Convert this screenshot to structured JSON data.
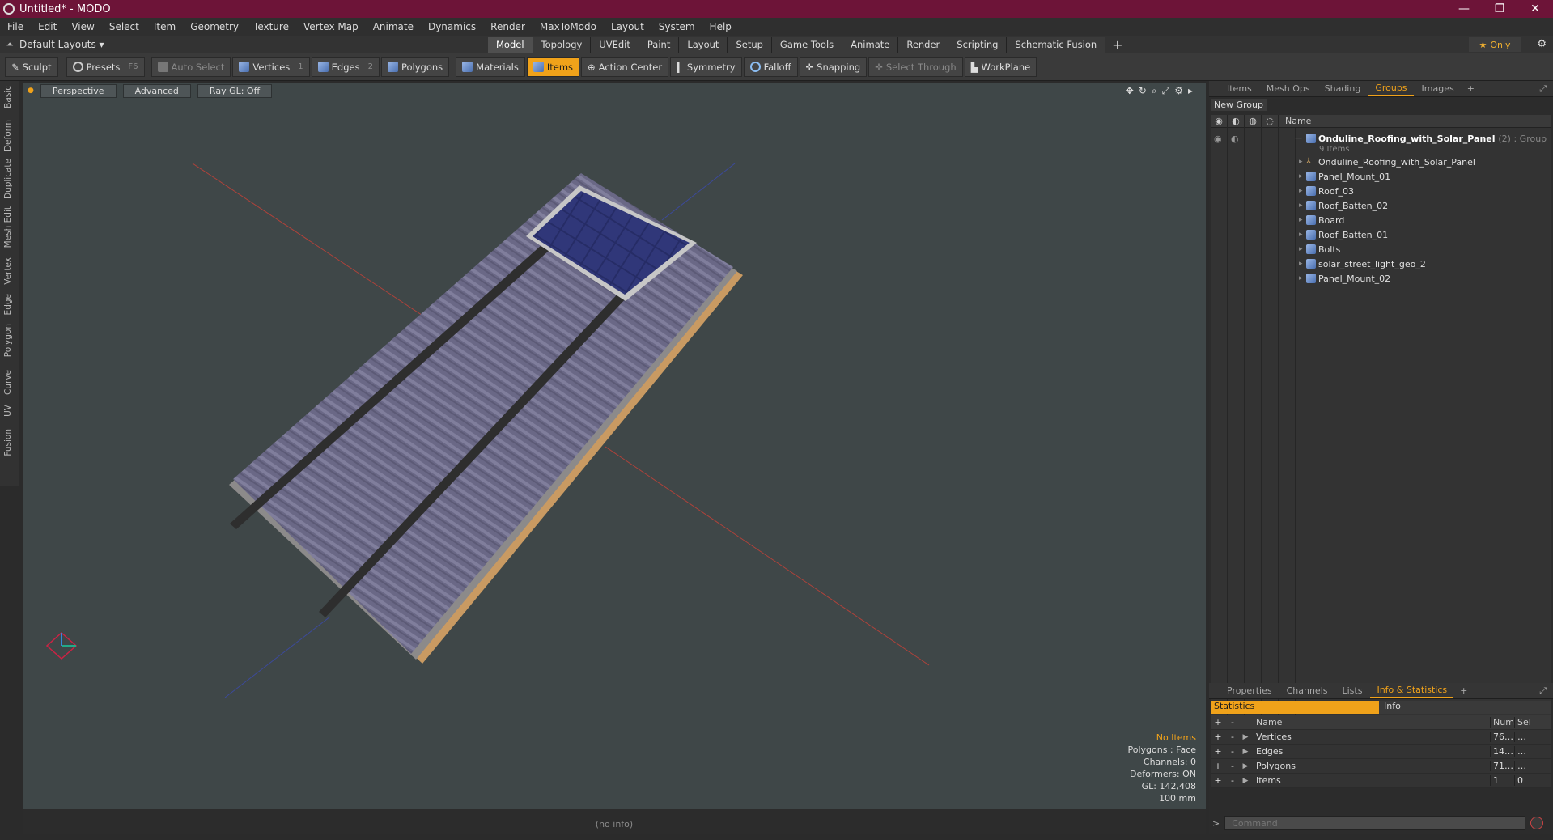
{
  "window": {
    "title": "Untitled* - MODO",
    "controls": [
      "—",
      "❐",
      "✕"
    ]
  },
  "menu": [
    "File",
    "Edit",
    "View",
    "Select",
    "Item",
    "Geometry",
    "Texture",
    "Vertex Map",
    "Animate",
    "Dynamics",
    "Render",
    "MaxToModo",
    "Layout",
    "System",
    "Help"
  ],
  "layout_bar": {
    "layout_name": "Default Layouts ▾",
    "tabs": [
      "Model",
      "Topology",
      "UVEdit",
      "Paint",
      "Layout",
      "Setup",
      "Game Tools",
      "Animate",
      "Render",
      "Scripting",
      "Schematic Fusion"
    ],
    "active_tab": "Model",
    "only_label": "Only"
  },
  "toolbar": {
    "sculpt": "Sculpt",
    "presets": "Presets",
    "presets_key": "F6",
    "auto_select": "Auto Select",
    "vertices": "Vertices",
    "vertices_key": "1",
    "edges": "Edges",
    "edges_key": "2",
    "polygons": "Polygons",
    "materials": "Materials",
    "items": "Items",
    "action_center": "Action Center",
    "symmetry": "Symmetry",
    "falloff": "Falloff",
    "snapping": "Snapping",
    "select_through": "Select Through",
    "workplane": "WorkPlane"
  },
  "left_tabs": [
    "Basic",
    "Deform",
    "Duplicate",
    "Mesh Edit",
    "Vertex",
    "Edge",
    "Polygon",
    "Curve",
    "UV",
    "Fusion"
  ],
  "viewport": {
    "view": "Perspective",
    "shading": "Advanced",
    "raygl": "Ray GL: Off",
    "info": {
      "no_items": "No Items",
      "polygons": "Polygons : Face",
      "channels": "Channels: 0",
      "deformers": "Deformers: ON",
      "gl": "GL: 142,408",
      "unit": "100 mm"
    }
  },
  "status": "(no info)",
  "right_panel": {
    "tabs": [
      "Items",
      "Mesh Ops",
      "Shading",
      "Groups",
      "Images"
    ],
    "active_tab": "Groups",
    "new_group": "New Group",
    "name_col": "Name",
    "group": {
      "name": "Onduline_Roofing_with_Solar_Panel",
      "suffix": "(2) : Group",
      "count": "9 Items"
    },
    "items": [
      "Onduline_Roofing_with_Solar_Panel",
      "Panel_Mount_01",
      "Roof_03",
      "Roof_Batten_02",
      "Board",
      "Roof_Batten_01",
      "Bolts",
      "solar_street_light_geo_2",
      "Panel_Mount_02"
    ]
  },
  "bottom_panel": {
    "tabs": [
      "Properties",
      "Channels",
      "Lists",
      "Info & Statistics"
    ],
    "active_tab": "Info & Statistics",
    "stat_tabs": [
      "Statistics",
      "Info"
    ],
    "headers": [
      "Name",
      "Num",
      "Sel"
    ],
    "rows": [
      {
        "name": "Vertices",
        "num": "76…",
        "sel": "…"
      },
      {
        "name": "Edges",
        "num": "14…",
        "sel": "…"
      },
      {
        "name": "Polygons",
        "num": "71…",
        "sel": "…"
      },
      {
        "name": "Items",
        "num": "1",
        "sel": "0"
      }
    ],
    "command_placeholder": "Command"
  },
  "colors": {
    "accent": "#f0a21a",
    "titlebar": "#6d1438",
    "viewport_bg": "#3f4748",
    "roof": "#6e6c8a",
    "panel": "#2a2f6a"
  }
}
